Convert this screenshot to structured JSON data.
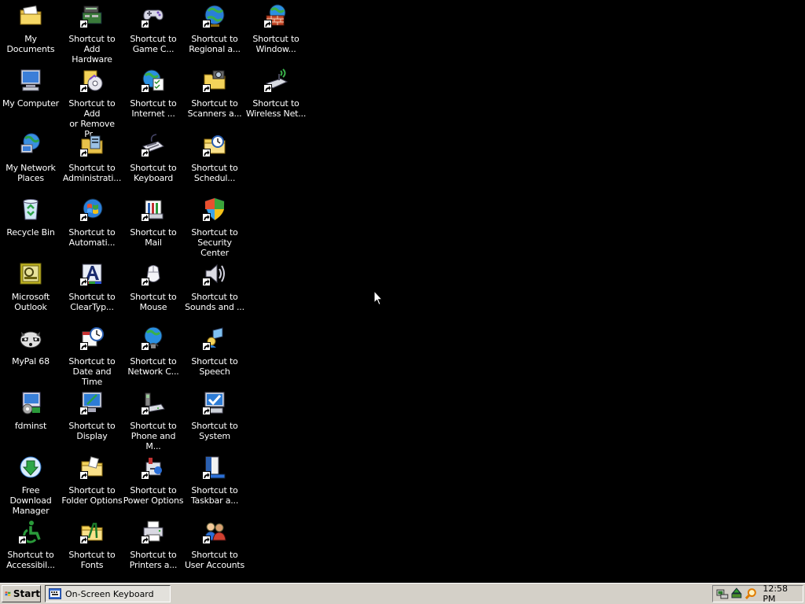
{
  "desktop": {
    "background": "#000000",
    "icons": [
      {
        "label": "My Documents",
        "icon": "folder-documents-icon",
        "shortcut": false
      },
      {
        "label": "My Computer",
        "icon": "computer-icon",
        "shortcut": false
      },
      {
        "label": "My Network\nPlaces",
        "icon": "network-places-icon",
        "shortcut": false
      },
      {
        "label": "Recycle Bin",
        "icon": "recycle-bin-icon",
        "shortcut": false
      },
      {
        "label": "Microsoft\nOutlook",
        "icon": "outlook-icon",
        "shortcut": false
      },
      {
        "label": "MyPal 68",
        "icon": "mypal-raccoon-icon",
        "shortcut": false
      },
      {
        "label": "fdminst",
        "icon": "installer-icon",
        "shortcut": false
      },
      {
        "label": "Free Download\nManager",
        "icon": "download-manager-icon",
        "shortcut": false
      },
      {
        "label": "Shortcut to\nAccessibil...",
        "icon": "accessibility-icon",
        "shortcut": true
      },
      {
        "label": "Shortcut to Add\nHardware",
        "icon": "add-hardware-icon",
        "shortcut": true
      },
      {
        "label": "Shortcut to Add\nor Remove Pr...",
        "icon": "add-remove-programs-icon",
        "shortcut": true
      },
      {
        "label": "Shortcut to\nAdministrati...",
        "icon": "admin-tools-icon",
        "shortcut": true
      },
      {
        "label": "Shortcut to\nAutomati...",
        "icon": "windows-update-icon",
        "shortcut": true
      },
      {
        "label": "Shortcut to\nClearTyp...",
        "icon": "cleartype-icon",
        "shortcut": true
      },
      {
        "label": "Shortcut to\nDate and Time",
        "icon": "date-time-icon",
        "shortcut": true
      },
      {
        "label": "Shortcut to\nDisplay",
        "icon": "display-icon",
        "shortcut": true
      },
      {
        "label": "Shortcut to\nFolder Options",
        "icon": "folder-options-icon",
        "shortcut": true
      },
      {
        "label": "Shortcut to\nFonts",
        "icon": "fonts-folder-icon",
        "shortcut": true
      },
      {
        "label": "Shortcut to\nGame C...",
        "icon": "game-controller-icon",
        "shortcut": true
      },
      {
        "label": "Shortcut to\nInternet ...",
        "icon": "internet-options-icon",
        "shortcut": true
      },
      {
        "label": "Shortcut to\nKeyboard",
        "icon": "keyboard-icon",
        "shortcut": true
      },
      {
        "label": "Shortcut to Mail",
        "icon": "mail-icon",
        "shortcut": true
      },
      {
        "label": "Shortcut to\nMouse",
        "icon": "mouse-icon",
        "shortcut": true
      },
      {
        "label": "Shortcut to\nNetwork C...",
        "icon": "network-connections-icon",
        "shortcut": true
      },
      {
        "label": "Shortcut to\nPhone and M...",
        "icon": "phone-modem-icon",
        "shortcut": true
      },
      {
        "label": "Shortcut to\nPower Options",
        "icon": "power-options-icon",
        "shortcut": true
      },
      {
        "label": "Shortcut to\nPrinters a...",
        "icon": "printers-icon",
        "shortcut": true
      },
      {
        "label": "Shortcut to\nRegional a...",
        "icon": "regional-globe-icon",
        "shortcut": true
      },
      {
        "label": "Shortcut to\nScanners a...",
        "icon": "scanners-cameras-icon",
        "shortcut": true
      },
      {
        "label": "Shortcut to\nSchedul...",
        "icon": "scheduled-tasks-icon",
        "shortcut": true
      },
      {
        "label": "Shortcut to\nSecurity Center",
        "icon": "security-shield-icon",
        "shortcut": true
      },
      {
        "label": "Shortcut to\nSounds and ...",
        "icon": "sounds-speaker-icon",
        "shortcut": true
      },
      {
        "label": "Shortcut to\nSpeech",
        "icon": "speech-icon",
        "shortcut": true
      },
      {
        "label": "Shortcut to\nSystem",
        "icon": "system-icon",
        "shortcut": true
      },
      {
        "label": "Shortcut to\nTaskbar a...",
        "icon": "taskbar-start-menu-icon",
        "shortcut": true
      },
      {
        "label": "Shortcut to\nUser Accounts",
        "icon": "user-accounts-icon",
        "shortcut": true
      },
      {
        "label": "Shortcut to\nWindow...",
        "icon": "firewall-icon",
        "shortcut": true
      },
      {
        "label": "Shortcut to\nWireless Net...",
        "icon": "wireless-network-icon",
        "shortcut": true
      }
    ]
  },
  "taskbar": {
    "start_label": "Start",
    "tasks": [
      {
        "label": "On-Screen Keyboard",
        "icon": "keyboard-icon"
      }
    ],
    "tray": {
      "icons": [
        "network-icon",
        "safely-remove-icon",
        "search-icon"
      ],
      "clock": "12:58 PM"
    }
  }
}
